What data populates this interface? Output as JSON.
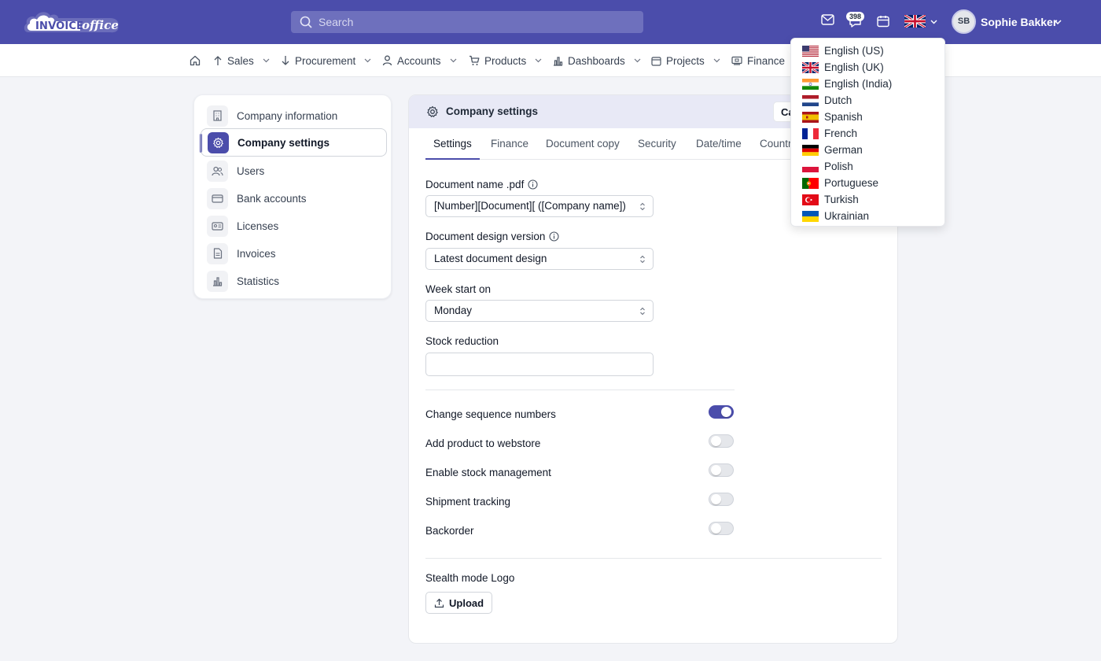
{
  "brand": {
    "logo_text_1": "INVOICE",
    "logo_text_2": "office"
  },
  "search": {
    "placeholder": "Search"
  },
  "header": {
    "notification_count": "398",
    "user_initials": "SB",
    "user_name": "Sophie Bakker",
    "accent": "#4b4dab"
  },
  "nav": {
    "items": [
      {
        "label": "Sales",
        "icon": "arrow-up-icon"
      },
      {
        "label": "Procurement",
        "icon": "arrow-down-icon"
      },
      {
        "label": "Accounts",
        "icon": "user-icon"
      },
      {
        "label": "Products",
        "icon": "cart-icon"
      },
      {
        "label": "Dashboards",
        "icon": "bar-chart-icon"
      },
      {
        "label": "Projects",
        "icon": "calendar-icon"
      },
      {
        "label": "Finance",
        "icon": "cash-icon"
      }
    ]
  },
  "sidebar": {
    "items": [
      {
        "label": "Company information",
        "icon": "building-icon"
      },
      {
        "label": "Company settings",
        "icon": "gear-icon",
        "active": true
      },
      {
        "label": "Users",
        "icon": "users-icon"
      },
      {
        "label": "Bank accounts",
        "icon": "credit-card-icon"
      },
      {
        "label": "Licenses",
        "icon": "id-card-icon"
      },
      {
        "label": "Invoices",
        "icon": "document-icon"
      },
      {
        "label": "Statistics",
        "icon": "bar-chart-icon"
      }
    ]
  },
  "main": {
    "title": "Company settings",
    "cancel_label": "Ca",
    "tabs": [
      "Settings",
      "Finance",
      "Document copy",
      "Security",
      "Date/time",
      "Countr"
    ],
    "active_tab": "Settings",
    "fields": {
      "doc_name_label": "Document name .pdf",
      "doc_name_value": "[Number][Document][ ([Company name])",
      "design_label": "Document design version",
      "design_value": "Latest document design",
      "week_label": "Week start on",
      "week_value": "Monday",
      "stock_label": "Stock reduction",
      "stock_value": ""
    },
    "toggles": [
      {
        "label": "Change sequence numbers",
        "on": true
      },
      {
        "label": "Add product to webstore",
        "on": false
      },
      {
        "label": "Enable stock management",
        "on": false
      },
      {
        "label": "Shipment tracking",
        "on": false
      },
      {
        "label": "Backorder",
        "on": false
      }
    ],
    "logo_label": "Stealth mode Logo",
    "upload_label": "Upload"
  },
  "languages": [
    {
      "label": "English (US)",
      "flag": "us-flag-icon"
    },
    {
      "label": "English (UK)",
      "flag": "uk-flag-icon"
    },
    {
      "label": "English (India)",
      "flag": "india-flag-icon"
    },
    {
      "label": "Dutch",
      "flag": "netherlands-flag-icon"
    },
    {
      "label": "Spanish",
      "flag": "spain-flag-icon"
    },
    {
      "label": "French",
      "flag": "france-flag-icon"
    },
    {
      "label": "German",
      "flag": "germany-flag-icon"
    },
    {
      "label": "Polish",
      "flag": "poland-flag-icon"
    },
    {
      "label": "Portuguese",
      "flag": "portugal-flag-icon"
    },
    {
      "label": "Turkish",
      "flag": "turkey-flag-icon"
    },
    {
      "label": "Ukrainian",
      "flag": "ukraine-flag-icon"
    }
  ]
}
